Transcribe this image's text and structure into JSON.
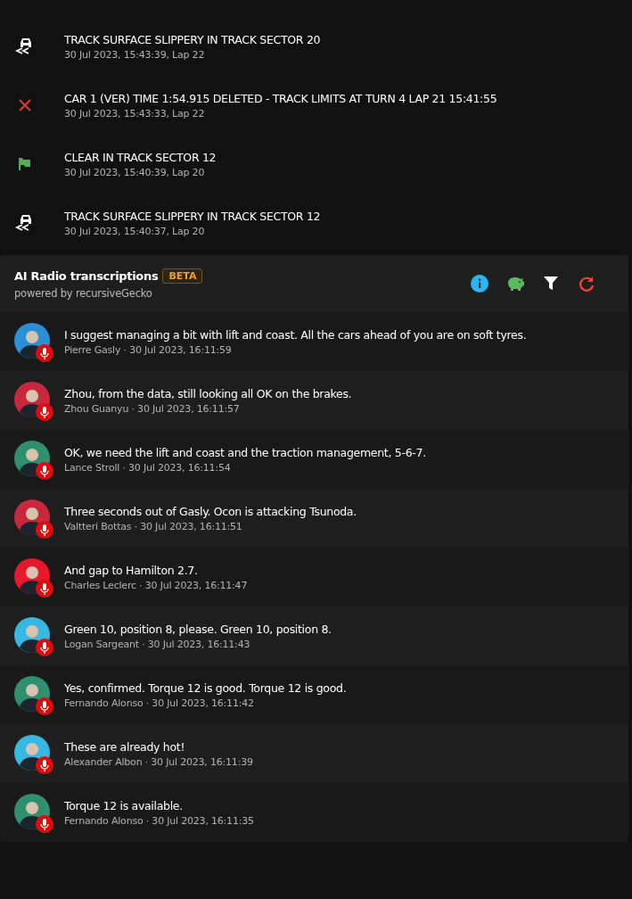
{
  "race_control": [
    {
      "kind": "slippery",
      "message": "TRACK SURFACE SLIPPERY IN TRACK SECTOR 20",
      "meta": "30 Jul 2023, 15:43:39, Lap 22"
    },
    {
      "kind": "deleted",
      "message": "CAR 1 (VER) TIME 1:54.915 DELETED - TRACK LIMITS AT TURN 4 LAP 21 15:41:55",
      "meta": "30 Jul 2023, 15:43:33, Lap 22"
    },
    {
      "kind": "flag",
      "message": "CLEAR IN TRACK SECTOR 12",
      "meta": "30 Jul 2023, 15:40:39, Lap 20"
    },
    {
      "kind": "slippery",
      "message": "TRACK SURFACE SLIPPERY IN TRACK SECTOR 12",
      "meta": "30 Jul 2023, 15:40:37, Lap 20"
    }
  ],
  "radio": {
    "title": "AI Radio transcriptions",
    "badge": "BETA",
    "subtitle": "powered by recursiveGecko",
    "messages": [
      {
        "text": "I suggest managing a bit with lift and coast. All the cars ahead of you are on soft tyres.",
        "meta": "Pierre Gasly · 30 Jul 2023, 16:11:59",
        "color": "#2b8fd6"
      },
      {
        "text": "Zhou, from the data, still looking all OK on the brakes.",
        "meta": "Zhou Guanyu · 30 Jul 2023, 16:11:57",
        "color": "#c8283c"
      },
      {
        "text": "OK, we need the lift and coast and the traction management, 5-6-7.",
        "meta": "Lance Stroll · 30 Jul 2023, 16:11:54",
        "color": "#2f8f6e"
      },
      {
        "text": "Three seconds out of Gasly. Ocon is attacking Tsunoda.",
        "meta": "Valtteri Bottas · 30 Jul 2023, 16:11:51",
        "color": "#c8283c"
      },
      {
        "text": "And gap to Hamilton 2.7.",
        "meta": "Charles Leclerc · 30 Jul 2023, 16:11:47",
        "color": "#e8182c"
      },
      {
        "text": "Green 10, position 8, please. Green 10, position 8.",
        "meta": "Logan Sargeant · 30 Jul 2023, 16:11:43",
        "color": "#36b8e0"
      },
      {
        "text": "Yes, confirmed. Torque 12 is good. Torque 12 is good.",
        "meta": "Fernando Alonso · 30 Jul 2023, 16:11:42",
        "color": "#2f8f6e"
      },
      {
        "text": "These are already hot!",
        "meta": "Alexander Albon · 30 Jul 2023, 16:11:39",
        "color": "#36b8e0"
      },
      {
        "text": "Torque 12 is available.",
        "meta": "Fernando Alonso · 30 Jul 2023, 16:11:35",
        "color": "#2f8f6e"
      }
    ]
  }
}
